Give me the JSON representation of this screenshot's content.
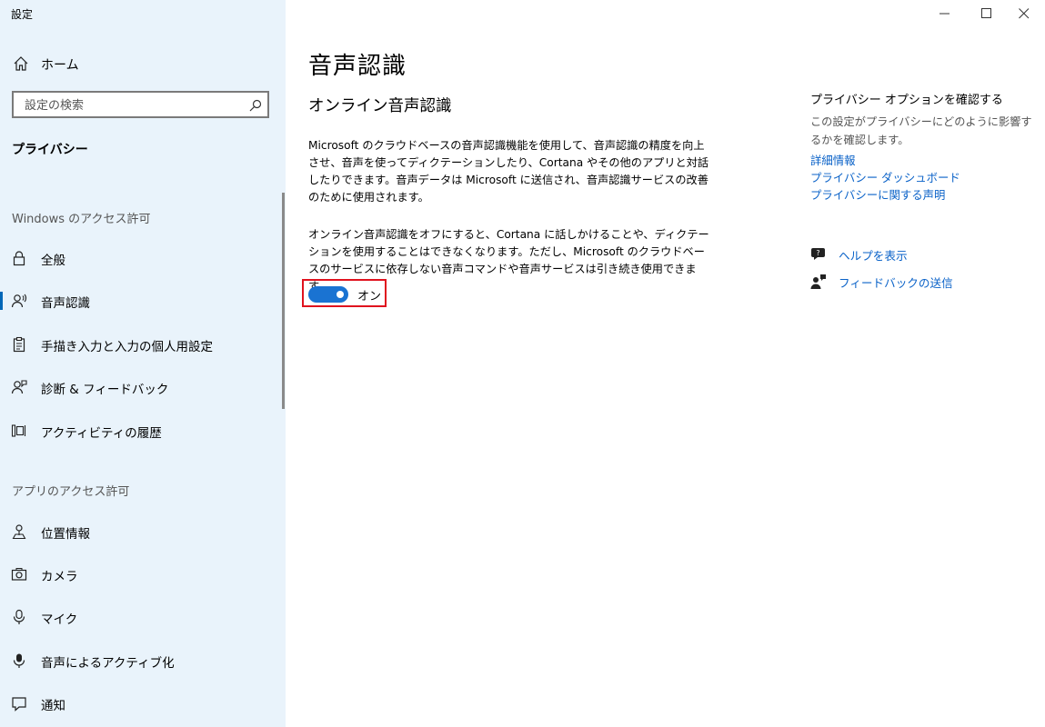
{
  "app": {
    "title": "設定"
  },
  "sidebar": {
    "home_label": "ホーム",
    "search_placeholder": "設定の検索",
    "section_title": "プライバシー",
    "groups": [
      {
        "header": "Windows のアクセス許可",
        "items": [
          {
            "label": "全般",
            "icon": "lock-icon"
          },
          {
            "label": "音声認識",
            "icon": "speech-icon",
            "selected": true
          },
          {
            "label": "手描き入力と入力の個人用設定",
            "icon": "clipboard-icon"
          },
          {
            "label": "診断 & フィードバック",
            "icon": "person-feedback-icon"
          },
          {
            "label": "アクティビティの履歴",
            "icon": "timeline-icon"
          }
        ]
      },
      {
        "header": "アプリのアクセス許可",
        "items": [
          {
            "label": "位置情報",
            "icon": "location-icon"
          },
          {
            "label": "カメラ",
            "icon": "camera-icon"
          },
          {
            "label": "マイク",
            "icon": "microphone-icon"
          },
          {
            "label": "音声によるアクティブ化",
            "icon": "voice-activation-icon"
          },
          {
            "label": "通知",
            "icon": "notification-icon"
          }
        ]
      }
    ]
  },
  "main": {
    "title": "音声認識",
    "subheading": "オンライン音声認識",
    "paragraph1": "Microsoft のクラウドベースの音声認識機能を使用して、音声認識の精度を向上させ、音声を使ってディクテーションしたり、Cortana やその他のアプリと対話したりできます。音声データは Microsoft に送信され、音声認識サービスの改善のために使用されます。",
    "paragraph2": "オンライン音声認識をオフにすると、Cortana に話しかけることや、ディクテーションを使用することはできなくなります。ただし、Microsoft のクラウドベースのサービスに依存しない音声コマンドや音声サービスは引き続き使用できます。",
    "toggle": {
      "state": "on",
      "label": "オン"
    }
  },
  "right": {
    "title": "プライバシー オプションを確認する",
    "description": "この設定がプライバシーにどのように影響するかを確認します。",
    "links": [
      "詳細情報",
      "プライバシー ダッシュボード",
      "プライバシーに関する声明"
    ],
    "help_label": "ヘルプを表示",
    "feedback_label": "フィードバックの送信"
  },
  "colors": {
    "sidebar_bg": "#e9f3fb",
    "accent": "#0067b8",
    "toggle_on": "#1a73d2",
    "highlight_border": "#e0121e",
    "link": "#0a62c8"
  }
}
